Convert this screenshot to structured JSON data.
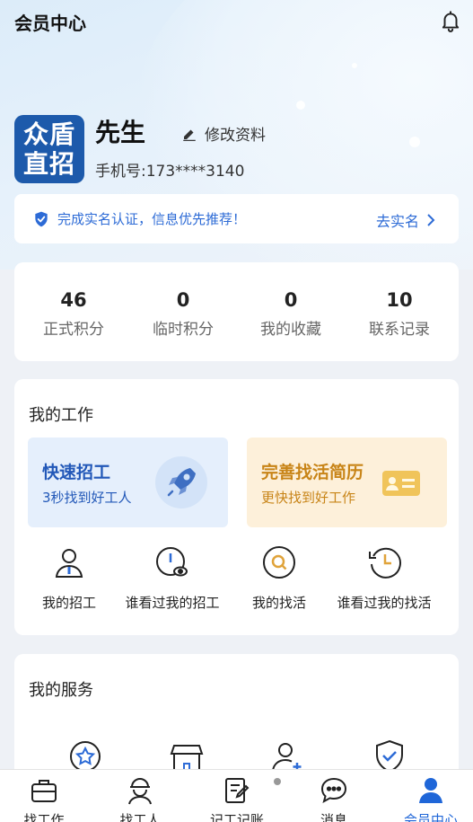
{
  "header": {
    "title": "会员中心"
  },
  "profile": {
    "logo_line1": "众盾",
    "logo_line2": "直招",
    "name": "先生",
    "edit_label": "修改资料",
    "phone": "手机号:173****3140"
  },
  "verify_banner": {
    "message": "完成实名认证，信息优先推荐！",
    "action": "去实名"
  },
  "stats": [
    {
      "value": "46",
      "label": "正式积分"
    },
    {
      "value": "0",
      "label": "临时积分"
    },
    {
      "value": "0",
      "label": "我的收藏"
    },
    {
      "value": "10",
      "label": "联系记录"
    }
  ],
  "my_work": {
    "title": "我的工作",
    "promo_hire": {
      "title": "快速招工",
      "subtitle": "3秒找到好工人"
    },
    "promo_resume": {
      "title": "完善找活简历",
      "subtitle": "更快找到好工作"
    },
    "quick_items": [
      {
        "label": "我的招工",
        "icon": "worker-icon"
      },
      {
        "label": "谁看过我的招工",
        "icon": "clock-eye-icon"
      },
      {
        "label": "我的找活",
        "icon": "search-circle-icon"
      },
      {
        "label": "谁看过我的找活",
        "icon": "history-icon"
      }
    ]
  },
  "my_service": {
    "title": "我的服务",
    "icons": [
      "star-badge-icon",
      "shop-icon",
      "add-user-icon",
      "shield-check-icon"
    ]
  },
  "tabbar": [
    {
      "label": "找工作",
      "icon": "briefcase-icon"
    },
    {
      "label": "找工人",
      "icon": "worker-helmet-icon"
    },
    {
      "label": "记工记账",
      "icon": "notebook-pen-icon"
    },
    {
      "label": "消息",
      "icon": "chat-bubble-icon"
    },
    {
      "label": "会员中心",
      "icon": "user-icon",
      "active": true
    }
  ],
  "colors": {
    "brand_blue": "#1d5aab",
    "accent_blue": "#2d6bd6",
    "orange": "#c88417",
    "active_tab": "#1f66d8"
  }
}
